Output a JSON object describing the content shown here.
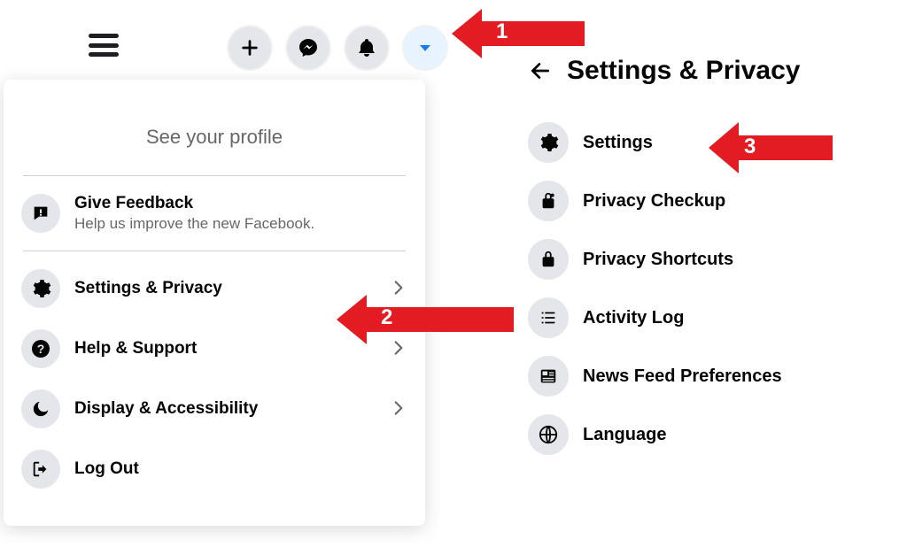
{
  "toolbar": {
    "hamburger_name": "menu-icon",
    "create_name": "create-icon",
    "messenger_name": "messenger-icon",
    "notifications_name": "notifications-icon",
    "account_name": "account-dropdown-icon"
  },
  "dropdown1": {
    "profile_link": "See your profile",
    "feedback": {
      "title": "Give Feedback",
      "sub": "Help us improve the new Facebook."
    },
    "settings_privacy": "Settings & Privacy",
    "help_support": "Help & Support",
    "display_accessibility": "Display & Accessibility",
    "log_out": "Log Out"
  },
  "panel2": {
    "title": "Settings & Privacy",
    "items": {
      "settings": "Settings",
      "privacy_checkup": "Privacy Checkup",
      "privacy_shortcuts": "Privacy Shortcuts",
      "activity_log": "Activity Log",
      "news_feed": "News Feed Preferences",
      "language": "Language"
    }
  },
  "annotations": {
    "1": "1",
    "2": "2",
    "3": "3"
  }
}
